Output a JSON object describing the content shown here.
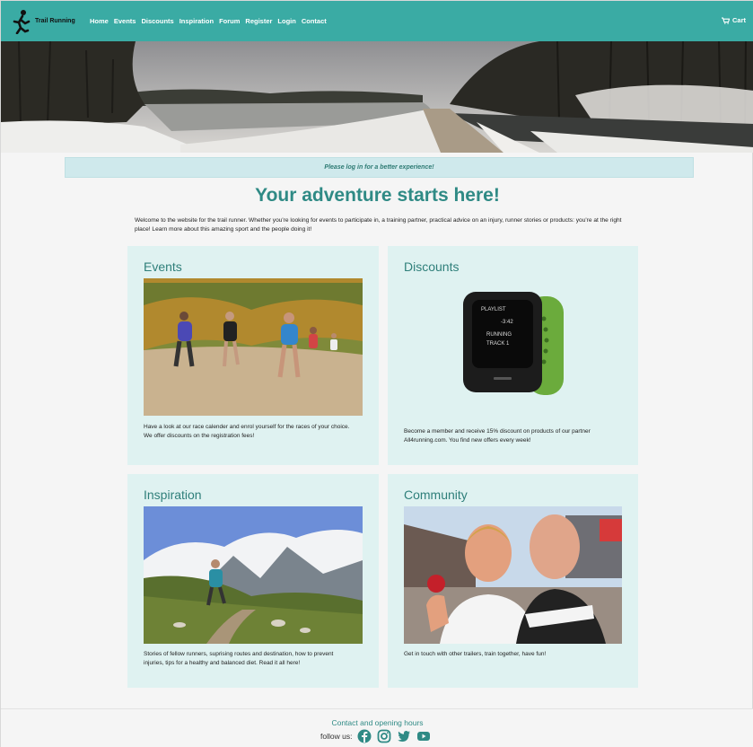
{
  "brand": {
    "name": "Trail Running",
    "logo_icon": "runner-icon"
  },
  "nav": {
    "items": [
      "Home",
      "Events",
      "Discounts",
      "Inspiration",
      "Forum",
      "Register",
      "Login",
      "Contact"
    ],
    "cart_label": "Cart",
    "cart_icon": "cart-icon"
  },
  "notice": "Please log in for a better experience!",
  "heading": "Your adventure starts here!",
  "intro": "Welcome to the website for the trail runner. Whether you're looking for events to participate in, a training partner, practical advice on an injury, runner stories or products: you're at the right place! Learn more about this amazing sport and the people doing it!",
  "cards": [
    {
      "title": "Events",
      "text": "Have a look at our race calender and enrol yourself for the races of your choice. We offer discounts on the registration fees!"
    },
    {
      "title": "Discounts",
      "text": "Become a member and receive 15% discount on products of our partner All4running.com. You find new offers every week!",
      "watch_text": [
        "PLAYLIST",
        "RUNNING",
        "TRACK 1",
        "-3:42"
      ]
    },
    {
      "title": "Inspiration",
      "text": "Stories of fellow runners, suprising routes and destination, how to prevent injuries, tips for a healthy and balanced diet. Read it all here!"
    },
    {
      "title": "Community",
      "text": "Get in touch with other trailers, train together, have fun!"
    }
  ],
  "footer": {
    "contact": "Contact and opening hours",
    "follow_label": "follow us:",
    "social_icons": [
      "facebook-icon",
      "instagram-icon",
      "twitter-icon",
      "youtube-icon"
    ]
  },
  "colors": {
    "nav": "#3aaba4",
    "card": "#dff2f1",
    "heading": "#2f8a85",
    "notice": "#cfe9ec"
  }
}
